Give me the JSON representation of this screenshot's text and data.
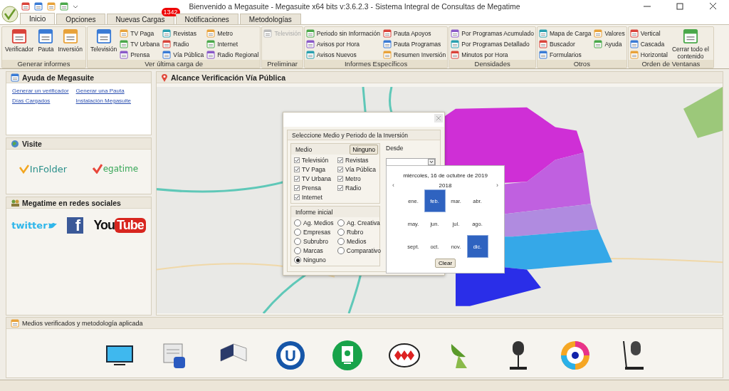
{
  "window": {
    "title": "Bienvenido a Megasuite - Megasuite x64 bits v:3.6.2.3 - Sistema Integral de Consultas de Megatime"
  },
  "tabs": [
    {
      "label": "Inicio",
      "selected": true
    },
    {
      "label": "Opciones",
      "selected": false
    },
    {
      "label": "Nuevas Cargas",
      "selected": false,
      "badge": "1342"
    },
    {
      "label": "Notificaciones",
      "selected": false
    },
    {
      "label": "Metodologías",
      "selected": false
    }
  ],
  "ribbon": [
    {
      "label": "Generar informes",
      "items": [
        {
          "label": "Verificador",
          "kind": "large",
          "disabled": false
        },
        {
          "label": "Pauta",
          "kind": "large",
          "disabled": false
        },
        {
          "label": "Inversión",
          "kind": "large",
          "disabled": false
        }
      ]
    },
    {
      "label": "Ver última carga de",
      "items": [
        {
          "label": "Televisión",
          "kind": "large",
          "disabled": false
        },
        {
          "label": "TV Paga",
          "kind": "small",
          "disabled": false
        },
        {
          "label": "TV Urbana",
          "kind": "small",
          "disabled": false
        },
        {
          "label": "Prensa",
          "kind": "small",
          "disabled": false
        },
        {
          "label": "Revistas",
          "kind": "small",
          "disabled": false
        },
        {
          "label": "Radio",
          "kind": "small",
          "disabled": false
        },
        {
          "label": "Vía Pública",
          "kind": "small",
          "disabled": false
        },
        {
          "label": "Metro",
          "kind": "small",
          "disabled": false
        },
        {
          "label": "Internet",
          "kind": "small",
          "disabled": false
        },
        {
          "label": "Radio Regional",
          "kind": "small",
          "disabled": false
        }
      ]
    },
    {
      "label": "Preliminar",
      "items": [
        {
          "label": "Televisión",
          "kind": "small",
          "disabled": true
        }
      ]
    },
    {
      "label": "Informes Específicos",
      "items": [
        {
          "label": "Periodo sin Información",
          "kind": "small",
          "disabled": false
        },
        {
          "label": "Avisos por Hora",
          "kind": "small",
          "disabled": false
        },
        {
          "label": "Avisos Nuevos",
          "kind": "small",
          "disabled": false
        },
        {
          "label": "Pauta Apoyos",
          "kind": "small",
          "disabled": false
        },
        {
          "label": "Pauta Programas",
          "kind": "small",
          "disabled": false
        },
        {
          "label": "Resumen Inversión",
          "kind": "small",
          "disabled": false
        }
      ]
    },
    {
      "label": "Densidades",
      "items": [
        {
          "label": "Por Programas Acumulado",
          "kind": "small",
          "disabled": false
        },
        {
          "label": "Por Programas Detallado",
          "kind": "small",
          "disabled": false
        },
        {
          "label": "Minutos por Hora",
          "kind": "small",
          "disabled": false
        }
      ]
    },
    {
      "label": "Otros",
      "items": [
        {
          "label": "Mapa de Carga",
          "kind": "small",
          "disabled": false
        },
        {
          "label": "Buscador",
          "kind": "small",
          "disabled": false
        },
        {
          "label": "Formularios",
          "kind": "small",
          "disabled": false
        },
        {
          "label": "Valores",
          "kind": "small",
          "disabled": false
        },
        {
          "label": "Ayuda",
          "kind": "small",
          "disabled": false
        }
      ]
    },
    {
      "label": "Orden de Ventanas",
      "items": [
        {
          "label": "Vertical",
          "kind": "small",
          "disabled": false
        },
        {
          "label": "Cascada",
          "kind": "small",
          "disabled": false
        },
        {
          "label": "Horizontal",
          "kind": "small",
          "disabled": false
        },
        {
          "label": "Cerrar todo el contenido",
          "kind": "large",
          "disabled": false
        }
      ]
    }
  ],
  "help_panel": {
    "title": "Ayuda de Megasuite",
    "links": [
      "Generar un verificador",
      "Generar una Pauta",
      "Días Cargados",
      "Instalación Megasuite"
    ]
  },
  "visit_panel": {
    "title": "Visite",
    "logos": [
      {
        "kind": "infolder",
        "text": "InFolder"
      },
      {
        "kind": "megatime",
        "text": "egatime"
      }
    ]
  },
  "social_panel": {
    "title": "Megatime en redes sociales",
    "logos": [
      {
        "kind": "twitter",
        "text": "twitter"
      },
      {
        "kind": "facebook",
        "text": "f"
      },
      {
        "kind": "youtube",
        "text": "You",
        "text2": "Tube"
      }
    ]
  },
  "map_panel": {
    "title": "Alcance Verificación Vía Pública"
  },
  "dialog": {
    "group_title": "Seleccione Medio y Periodo de la Inversión",
    "medio_label": "Medio",
    "none_button": "Ninguno",
    "media": [
      {
        "label": "Televisión",
        "checked": true
      },
      {
        "label": "Revistas",
        "checked": true
      },
      {
        "label": "TV Paga",
        "checked": true
      },
      {
        "label": "Vía Pública",
        "checked": true
      },
      {
        "label": "TV Urbana",
        "checked": true
      },
      {
        "label": "Metro",
        "checked": true
      },
      {
        "label": "Prensa",
        "checked": true
      },
      {
        "label": "Radio",
        "checked": true
      },
      {
        "label": "Internet",
        "checked": true
      }
    ],
    "report_label": "Informe inicial",
    "reports": [
      {
        "label": "Ag. Medios",
        "selected": false
      },
      {
        "label": "Ag. Creativa",
        "selected": false
      },
      {
        "label": "Empresas",
        "selected": false
      },
      {
        "label": "Rubro",
        "selected": false
      },
      {
        "label": "Subrubro",
        "selected": false
      },
      {
        "label": "Medios",
        "selected": false
      },
      {
        "label": "Marcas",
        "selected": false
      },
      {
        "label": "Comparativo",
        "selected": false
      },
      {
        "label": "Ninguno",
        "selected": true
      }
    ],
    "from_label": "Desde"
  },
  "calendar": {
    "today": "miércoles, 16 de octubre de 2019",
    "prev": "‹",
    "year": "2018",
    "next": "›",
    "months": [
      {
        "label": "ene.",
        "selected": false
      },
      {
        "label": "feb.",
        "selected": true
      },
      {
        "label": "mar.",
        "selected": false
      },
      {
        "label": "abr.",
        "selected": false
      },
      {
        "label": "may.",
        "selected": false
      },
      {
        "label": "jun.",
        "selected": false
      },
      {
        "label": "jul.",
        "selected": false
      },
      {
        "label": "ago.",
        "selected": false
      },
      {
        "label": "sept.",
        "selected": false
      },
      {
        "label": "oct.",
        "selected": false
      },
      {
        "label": "nov.",
        "selected": false
      },
      {
        "label": "dic.",
        "selected": true
      }
    ],
    "clear": "Clear"
  },
  "media_panel": {
    "title": "Medios verificados y metodología aplicada",
    "icons": [
      {
        "kind": "tv"
      },
      {
        "kind": "newspaper"
      },
      {
        "kind": "magazine"
      },
      {
        "kind": "u_logo",
        "text": "U"
      },
      {
        "kind": "billboard"
      },
      {
        "kind": "metro"
      },
      {
        "kind": "satellite"
      },
      {
        "kind": "microphone"
      },
      {
        "kind": "eye"
      },
      {
        "kind": "studio_mic"
      }
    ]
  }
}
